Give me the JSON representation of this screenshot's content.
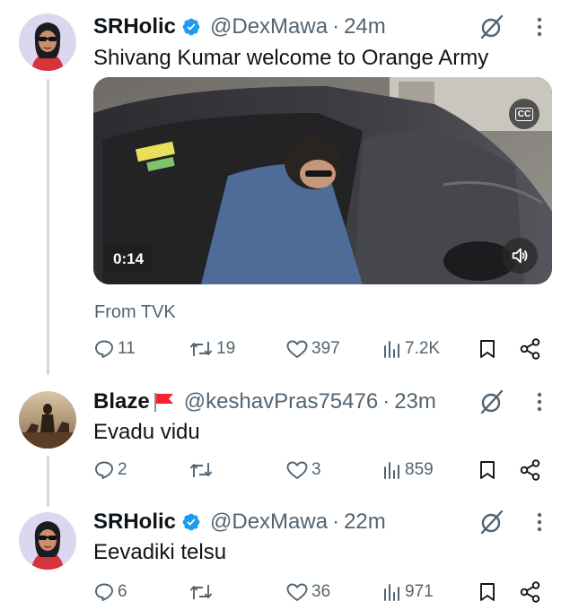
{
  "colors": {
    "text": "#0f1419",
    "secondary": "#536471",
    "verified": "#1d9bf0",
    "thread_line": "#cfd9de",
    "flag": "#f4212e"
  },
  "tweets": [
    {
      "name": "SRHolic",
      "verified": true,
      "handle": "@DexMawa",
      "dot": "·",
      "time": "24m",
      "text": "Shivang Kumar welcome to Orange Army",
      "media": {
        "cc_label": "CC",
        "duration": "0:14",
        "source": "From TVK"
      },
      "actions": {
        "replies": "11",
        "retweets": "19",
        "likes": "397",
        "views": "7.2K"
      }
    },
    {
      "name": "Blaze",
      "flag_emoji": "🚩",
      "verified": false,
      "handle": "@keshavPras75476",
      "dot": "·",
      "time": "23m",
      "text": "Evadu vidu",
      "actions": {
        "replies": "2",
        "retweets": "",
        "likes": "3",
        "views": "859"
      }
    },
    {
      "name": "SRHolic",
      "verified": true,
      "handle": "@DexMawa",
      "dot": "·",
      "time": "22m",
      "text": "Eevadiki telsu",
      "actions": {
        "replies": "6",
        "retweets": "",
        "likes": "36",
        "views": "971"
      }
    }
  ],
  "icons": {
    "verified": "verified-badge-icon",
    "grok": "grok-icon",
    "more": "more-options-icon",
    "reply": "reply-icon",
    "retweet": "retweet-icon",
    "like": "like-icon",
    "views": "views-icon",
    "bookmark": "bookmark-icon",
    "share": "share-icon",
    "volume": "volume-icon"
  }
}
